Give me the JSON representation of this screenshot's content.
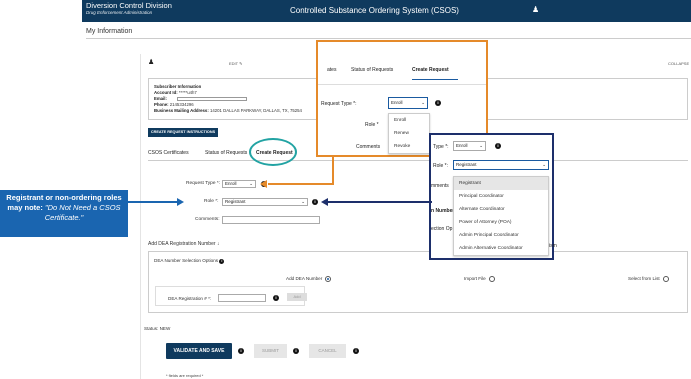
{
  "header": {
    "org_title": "Diversion Control Division",
    "org_subtitle": "Drug Enforcement Administration",
    "app_title": "Controlled Substance Ordering System (CSOS)",
    "user_icon": "person-icon"
  },
  "page": {
    "section_title": "My Information"
  },
  "panel": {
    "edit_label": "EDIT",
    "collapse_label": "COLLAPSE",
    "subscriber_heading": "Subscriber Information",
    "account_label": "Account Id:",
    "account_value": "*****u4h7",
    "email_label": "Email:",
    "phone_label": "Phone:",
    "phone_value": "2145334296",
    "address_label": "Business Mailing Address:",
    "address_value": "14201 DALLAS PARKWAY, DALLAS, TX, 75254",
    "instructions_button": "CREATE REQUEST INSTRUCTIONS"
  },
  "tabs": [
    "CSOS Certificates",
    "Status of Requests",
    "Create Request"
  ],
  "form": {
    "request_type_label": "Request Type *:",
    "request_type_value": "Enroll",
    "role_label": "Role *:",
    "role_value": "Registrant",
    "comments_label": "Comments:"
  },
  "dea": {
    "section_title": "Add DEA Registration Number",
    "options_label": "DEA Number Selection Options",
    "opt_add": "Add DEA Number",
    "opt_import": "Import File",
    "opt_list": "Select from List",
    "reg_label": "DEA Registration # *:",
    "add_button": "Add"
  },
  "status_text": "Status: NEW",
  "actions": {
    "validate": "VALIDATE AND SAVE",
    "submit": "SUBMIT",
    "cancel": "CANCEL"
  },
  "footer_note": "* fields are required *",
  "callout1": {
    "tab_partial": "ates",
    "tab_status": "Status of Requests",
    "tab_create": "Create Request",
    "request_type_label": "Request Type *:",
    "request_type_value": "Enroll",
    "role_label": "Role *",
    "comments_label": "Comments",
    "menu_items": [
      "Enroll",
      "Renew",
      "Revoke"
    ]
  },
  "callout2": {
    "type_label": "Type *:",
    "type_value": "Enroll",
    "role_label": "Role *:",
    "role_value": "Registrant",
    "comments_partial": "mments",
    "number_partial": "n Number",
    "options_partial": "ection Op",
    "right_partial": "ism",
    "menu_items": [
      "Registrant",
      "Principal Coordinator",
      "Alternate Coordinator",
      "Power of Attorney (POA)",
      "Admin Principal Coordinator",
      "Admin Alternative Coordinator"
    ]
  },
  "annotation": {
    "bold_text": "Registrant or non-ordering roles may note:",
    "italic_text": "\"Do Not Need a CSOS Certificate.\""
  },
  "colors": {
    "header_bg": "#0f3a5e",
    "callout_orange": "#e58a2a",
    "callout_navy": "#1d2f6b",
    "note_blue": "#1a65b0",
    "highlight_teal": "#22a3a3"
  }
}
